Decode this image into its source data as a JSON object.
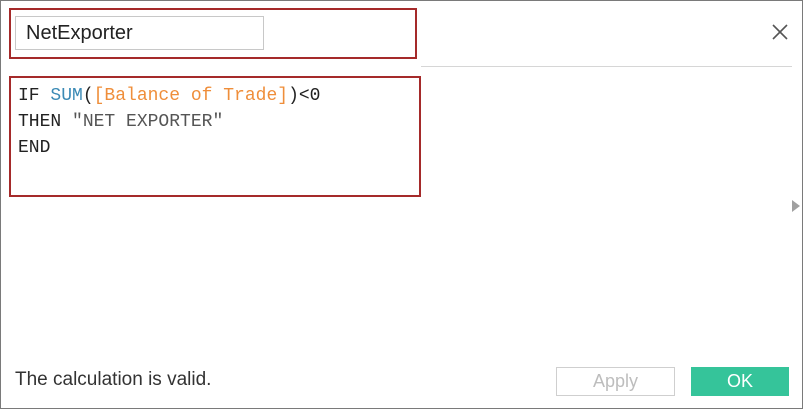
{
  "dialog": {
    "name_field": {
      "value": "NetExporter"
    },
    "close_icon": "close-icon",
    "expand_icon": "triangle-right-icon"
  },
  "formula": {
    "line1": {
      "kw_if": "IF ",
      "func_sum": "SUM",
      "paren_open": "(",
      "field": "[Balance of Trade]",
      "tail": ")<0"
    },
    "line2": {
      "kw_then": "THEN ",
      "string": "\"NET EXPORTER\""
    },
    "line3": {
      "kw_end": "END"
    }
  },
  "footer": {
    "status": "The calculation is valid.",
    "apply_label": "Apply",
    "ok_label": "OK"
  },
  "colors": {
    "highlight_border": "#a52a2a",
    "function": "#3b8ab5",
    "field": "#ef8e3a",
    "ok_button": "#35c49a"
  }
}
